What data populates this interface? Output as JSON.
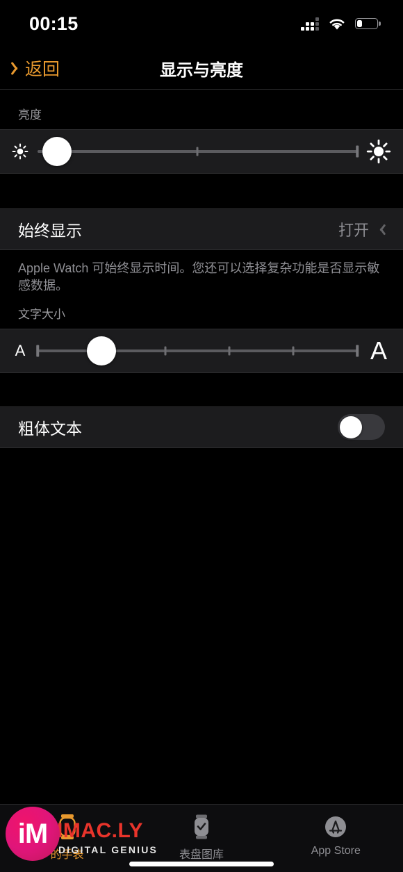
{
  "status_bar": {
    "time": "00:15",
    "cellular_icon": "cellular-signal-icon",
    "wifi_icon": "wifi-icon",
    "battery_icon": "battery-low-icon",
    "battery_level_percent": 25
  },
  "nav": {
    "back_label": "返回",
    "back_icon": "chevron-left-icon",
    "title": "显示与亮度",
    "accent_color": "#E8992E"
  },
  "brightness": {
    "header": "亮度",
    "icon_low": "sun-small-icon",
    "icon_high": "sun-large-icon",
    "value_percent": 6,
    "ticks_percent": [
      50,
      100
    ]
  },
  "always_on": {
    "label": "始终显示",
    "value": "打开",
    "chevron_icon": "chevron-right-icon",
    "footer": "Apple Watch 可始终显示时间。您还可以选择复杂功能是否显示敏感数据。"
  },
  "text_size": {
    "header": "文字大小",
    "icon_small": "A",
    "icon_large": "A",
    "steps": 6,
    "selected_step": 1,
    "ticks_percent": [
      0,
      40,
      60,
      80,
      100
    ]
  },
  "bold_text": {
    "label": "粗体文本",
    "toggle_state": "off",
    "toggle_track_color": "#39393d"
  },
  "tab_bar": {
    "items": [
      {
        "label": "的手表",
        "icon": "watch-icon",
        "active": true
      },
      {
        "label": "表盘图库",
        "icon": "watch-face-gallery-icon",
        "active": false
      },
      {
        "label": "App Store",
        "icon": "app-store-icon",
        "active": false
      }
    ]
  },
  "watermark": {
    "mark": "iM",
    "brand": "IMAC.LY",
    "tagline": "DIGITAL GENIUS",
    "circle_color": "#e0157a",
    "brand_color": "#E8342B"
  }
}
